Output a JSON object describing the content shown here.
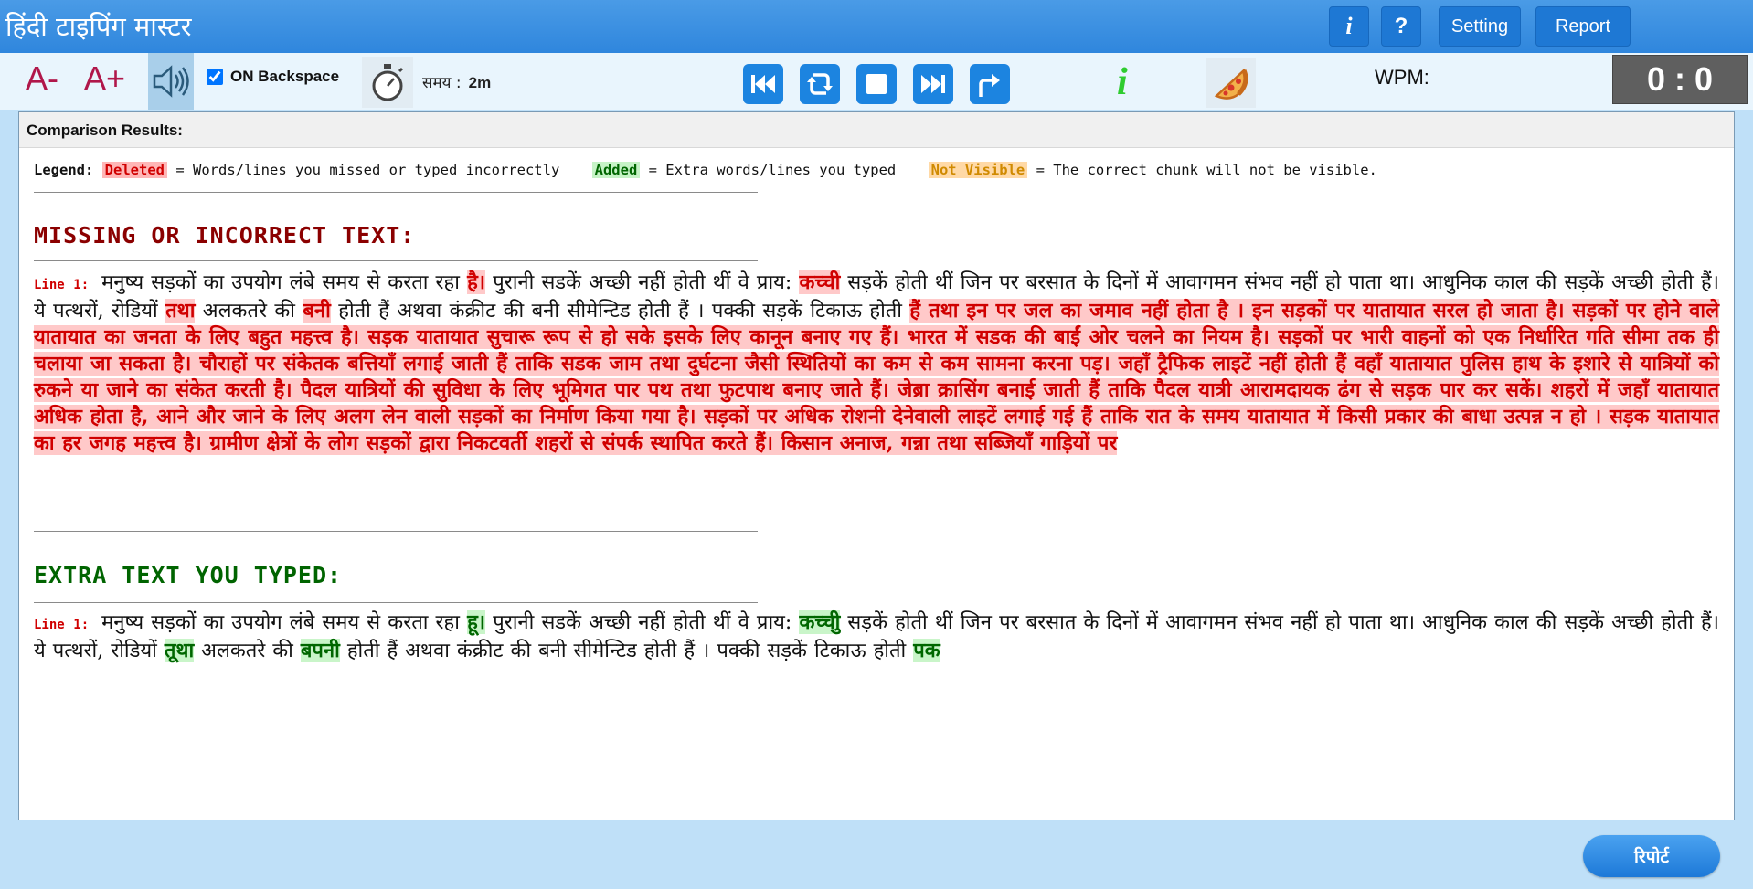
{
  "app": {
    "title": "हिंदी टाइपिंग मास्टर"
  },
  "titlebar": {
    "info_label": "i",
    "help_label": "?",
    "setting_label": "Setting",
    "report_label": "Report"
  },
  "toolbar": {
    "font_decrease": "A-",
    "font_increase": "A+",
    "backspace_label": "ON Backspace",
    "backspace_checked": true,
    "time_label": "समय :",
    "time_value": "2m",
    "info_label": "i",
    "wpm_label": "WPM:",
    "score": "0 : 0",
    "icons": [
      "speaker-icon",
      "stopwatch-icon",
      "skip-back-icon",
      "refresh-icon",
      "stop-icon",
      "skip-forward-icon",
      "share-icon",
      "info-icon",
      "pizza-icon"
    ]
  },
  "results": {
    "header": "Comparison Results:",
    "legend": {
      "label": "Legend:",
      "deleted_tag": "Deleted",
      "deleted_desc": "= Words/lines you missed or typed incorrectly",
      "added_tag": "Added",
      "added_desc": "= Extra words/lines you typed",
      "not_visible_tag": "Not Visible",
      "not_visible_desc": "= The correct chunk will not be visible."
    },
    "missing": {
      "title": "MISSING OR INCORRECT TEXT:",
      "line_label": "Line 1:",
      "t1": "मनुष्य सड़कों का उपयोग लंबे समय से करता रहा ",
      "d1": "है।",
      "t2": " पुरानी सडकें अच्छी नहीं होती थीं वे प्राय: ",
      "d2": "कच्ची",
      "t3": " सड़कें होती थीं जिन पर बरसात के दिनों में आवागमन संभव नहीं हो पाता था। आधुनिक काल की सड़कें अच्छी होती हैं। ये पत्थरों, रोडियों ",
      "d3": "तथा",
      "t4": " अलकतरे की ",
      "d4": "बनी",
      "t5": " होती हैं अथवा कंक्रीट की बनी सीमेन्टिड होती हैं । पक्की सड़कें टिकाऊ होती ",
      "d5": "हैं तथा इन पर जल का जमाव नहीं होता है । इन सड़कों पर यातायात सरल हो जाता है। सड़कों पर होने वाले यातायात का जनता के लिए बहुत महत्त्व है। सड़क यातायात सुचारू रूप से हो सके इसके लिए कानून बनाए गए हैं। भारत में सडक की बाईं ओर चलने का नियम है। सड़कों पर भारी वाहनों को एक निर्धारित गति सीमा तक ही चलाया जा सकता है। चौराहों पर संकेतक बत्तियाँ लगाई जाती हैं ताकि सडक जाम तथा दुर्घटना जैसी स्थितियों का कम से कम सामना करना पड़। जहाँ ट्रैफिक लाइटें नहीं होती हैं वहाँ यातायात पुलिस हाथ के इशारे से यात्रियों को रुकने या जाने का संकेत करती है। पैदल यात्रियों की सुविधा के लिए भूमिगत पार पथ तथा फुटपाथ बनाए जाते हैं। जेब्रा क्रासिंग बनाई जाती हैं ताकि पैदल यात्री आरामदायक ढंग से सड़क पार कर सकें। शहरों में जहाँ यातायात अधिक होता है, आने और जाने के लिए अलग लेन वाली सड़कों का निर्माण किया गया है। सड़कों पर अधिक रोशनी देनेवाली लाइटें लगाई गई हैं ताकि रात के समय यातायात में किसी प्रकार की बाधा उत्पन्न न हो । सड़क यातायात का हर जगह महत्त्व है। ग्रामीण क्षेत्रों के लोग सड़कों द्वारा निकटवर्ती शहरों से संपर्क स्थापित करते हैं। किसान अनाज, गन्ना तथा सब्जियाँ गाड़ियों पर"
    },
    "extra": {
      "title": "EXTRA TEXT YOU TYPED:",
      "line_label": "Line 1:",
      "t1": "मनुष्य सड़कों का उपयोग लंबे समय से करता रहा ",
      "a1": "हू।",
      "t2": " पुरानी सडकें अच्छी नहीं होती थीं वे प्राय: ",
      "a2": "कच्चीु",
      "t3": " सड़कें होती थीं जिन पर बरसात के दिनों में आवागमन संभव नहीं हो पाता था। आधुनिक काल की सड़कें अच्छी होती हैं। ये पत्थरों, रोडियों ",
      "a3": "तूथा",
      "t4": " अलकतरे की ",
      "a4": "बपनी",
      "t5": " होती हैं अथवा कंक्रीट की बनी सीमेन्टिड होती हैं । पक्की सड़कें टिकाऊ होती ",
      "a5": "पक"
    }
  },
  "footer": {
    "report_label": "रिपोर्ट"
  }
}
